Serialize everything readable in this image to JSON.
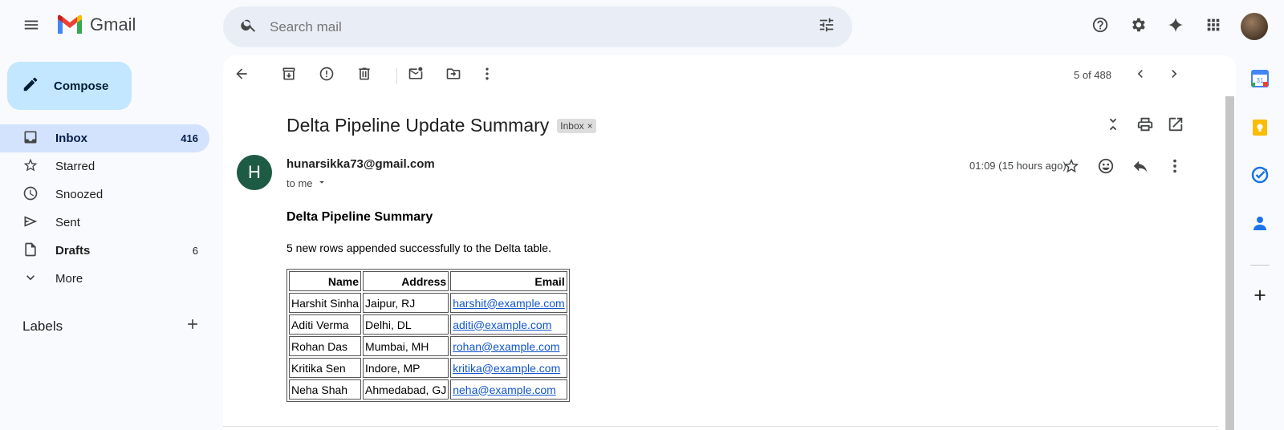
{
  "header": {
    "app_name": "Gmail",
    "search_placeholder": "Search mail"
  },
  "sidebar": {
    "compose_label": "Compose",
    "items": [
      {
        "label": "Inbox",
        "count": "416",
        "icon": "inbox-icon",
        "active": true
      },
      {
        "label": "Starred",
        "count": "",
        "icon": "star-icon"
      },
      {
        "label": "Snoozed",
        "count": "",
        "icon": "clock-icon"
      },
      {
        "label": "Sent",
        "count": "",
        "icon": "send-icon"
      },
      {
        "label": "Drafts",
        "count": "6",
        "icon": "draft-icon"
      },
      {
        "label": "More",
        "count": "",
        "icon": "chevron-down-icon"
      }
    ],
    "labels_title": "Labels"
  },
  "toolbar": {
    "pager_text": "5 of 488"
  },
  "email": {
    "subject": "Delta Pipeline Update Summary",
    "label_chip": "Inbox",
    "sender_initial": "H",
    "sender": "hunarsikka73@gmail.com",
    "to_text": "to me",
    "time": "01:09 (15 hours ago)",
    "body_heading": "Delta Pipeline Summary",
    "body_text": "5 new rows appended successfully to the Delta table.",
    "table": {
      "headers": [
        "Name",
        "Address",
        "Email"
      ],
      "rows": [
        [
          "Harshit Sinha",
          "Jaipur, RJ",
          "harshit@example.com"
        ],
        [
          "Aditi Verma",
          "Delhi, DL",
          "aditi@example.com"
        ],
        [
          "Rohan Das",
          "Mumbai, MH",
          "rohan@example.com"
        ],
        [
          "Kritika Sen",
          "Indore, MP",
          "kritika@example.com"
        ],
        [
          "Neha Shah",
          "Ahmedabad, GJ",
          "neha@example.com"
        ]
      ]
    }
  },
  "colors": {
    "compose_bg": "#c2e7ff",
    "active_nav_bg": "#d3e3fd",
    "avatar_bg": "#1e5b45",
    "link": "#1155cc"
  }
}
